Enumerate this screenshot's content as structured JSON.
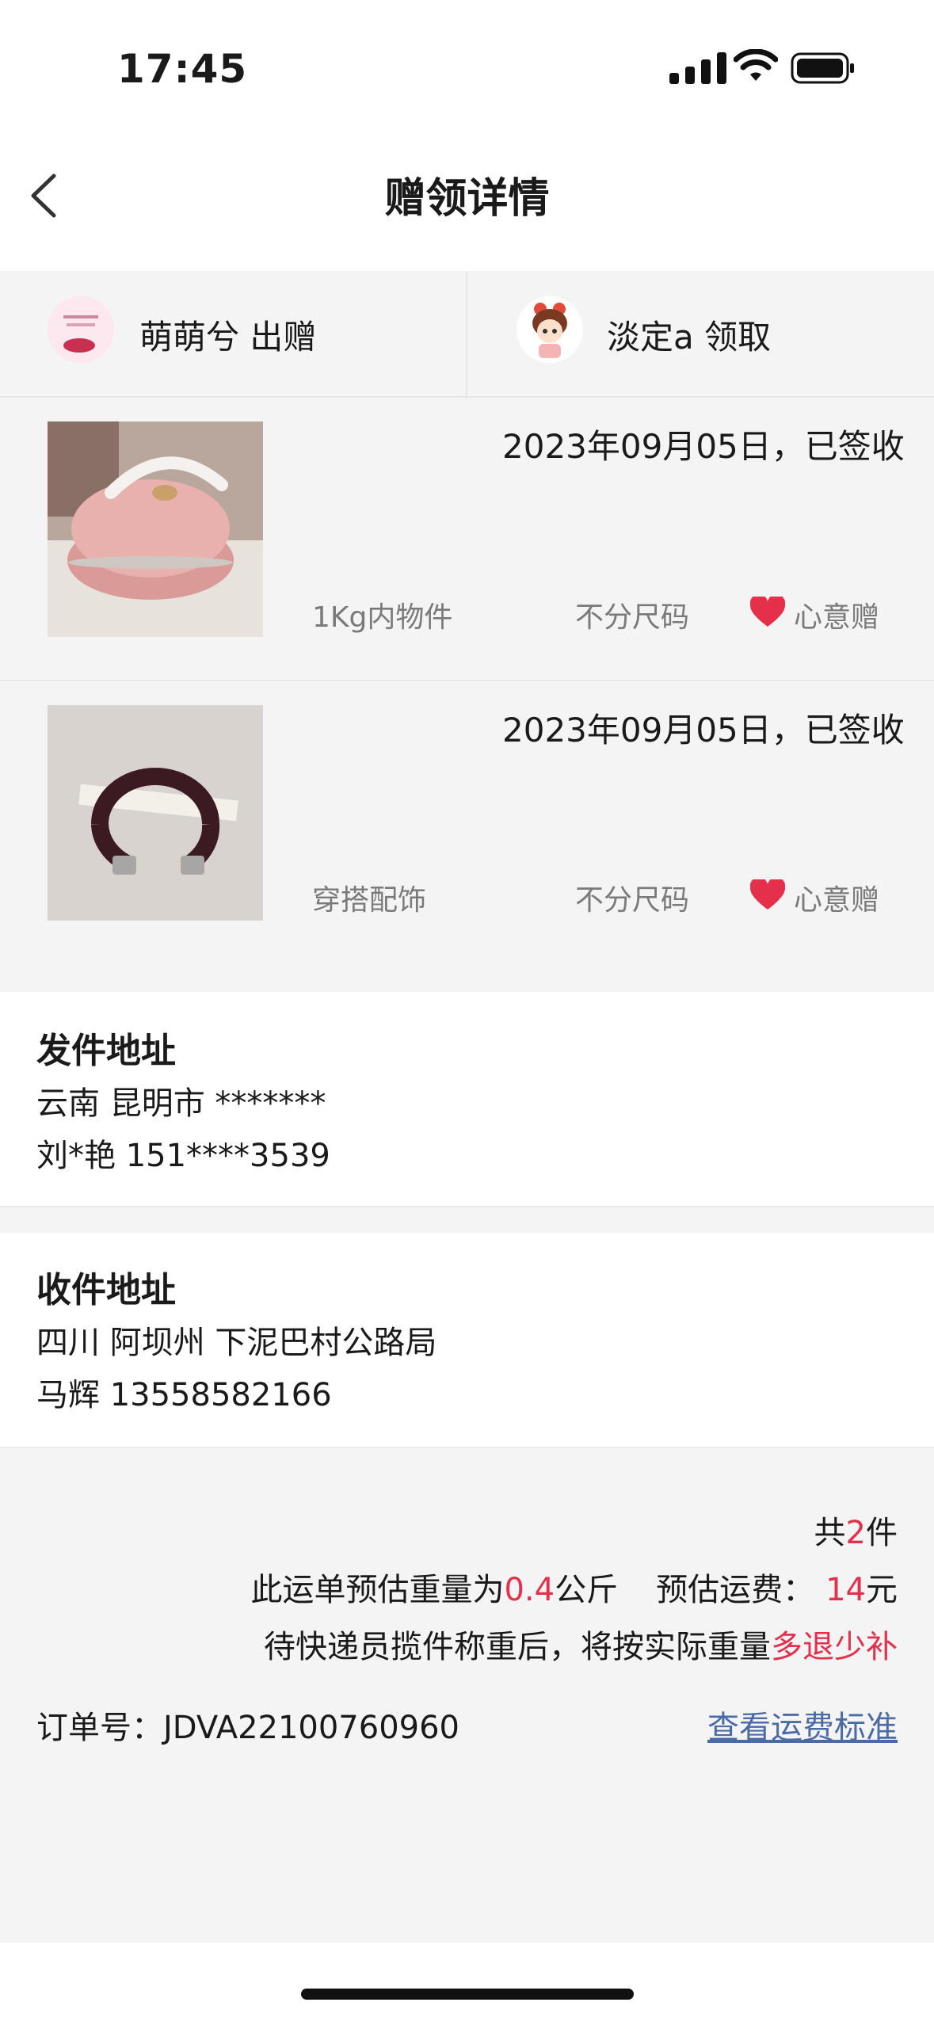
{
  "status_bar": {
    "time": "17:45"
  },
  "header": {
    "title": "赠领详情"
  },
  "giver": {
    "name_action": "萌萌兮 出赠"
  },
  "receiver": {
    "name_action": "淡定a 领取"
  },
  "items": [
    {
      "date_status": "2023年09月05日，已签收",
      "category": "1Kg内物件",
      "size": "不分尺码",
      "gift_type": "心意赠",
      "image": "pink-round-container"
    },
    {
      "date_status": "2023年09月05日，已签收",
      "category": "穿搭配饰",
      "size": "不分尺码",
      "gift_type": "心意赠",
      "image": "dark-bangle-bracelet"
    }
  ],
  "sender_address": {
    "title": "发件地址",
    "region": "云南 昆明市 *******",
    "contact": "刘*艳 151****3539"
  },
  "receiver_address": {
    "title": "收件地址",
    "region": "四川 阿坝州 下泥巴村公路局",
    "contact": "马辉 13558582166"
  },
  "summary": {
    "count_prefix": "共",
    "count": "2",
    "count_suffix": "件",
    "weight_prefix": "此运单预估重量为",
    "weight": "0.4",
    "weight_unit": "公斤",
    "fee_label": "预估运费：",
    "fee": "14",
    "fee_unit": "元",
    "note_prefix": "待快递员揽件称重后，将按实际重量",
    "note_highlight": "多退少补"
  },
  "order": {
    "label": "订单号：",
    "number": "JDVA22100760960",
    "fee_standard_link": "查看运费标准"
  },
  "colors": {
    "accent_red": "#e5304c",
    "link_blue": "#4a6aa8",
    "background_grey": "#f4f4f4"
  }
}
